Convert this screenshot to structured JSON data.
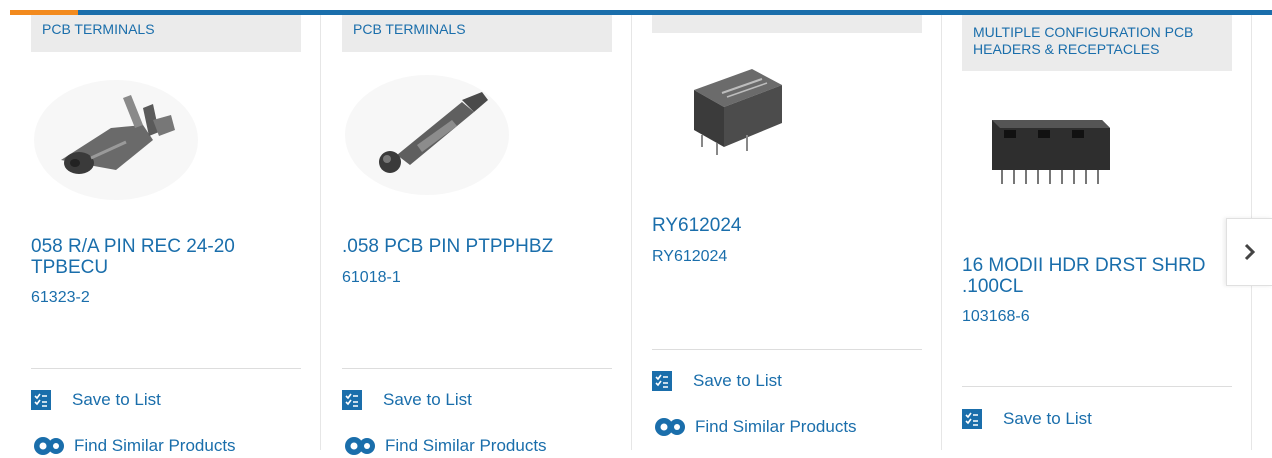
{
  "products": [
    {
      "category": "PCB TERMINALS",
      "title": "058 R/A PIN REC 24-20 TPBECU",
      "part_number": "61323-2",
      "image": "right-angle-pin-receptacle-image",
      "actions": {
        "save": "Save to List",
        "similar": "Find Similar Products"
      }
    },
    {
      "category": "PCB TERMINALS",
      "title": ".058 PCB PIN PTPPHBZ",
      "part_number": "61018-1",
      "image": "pcb-pin-image",
      "actions": {
        "save": "Save to List",
        "similar": "Find Similar Products"
      }
    },
    {
      "category": "",
      "title": "RY612024",
      "part_number": "RY612024",
      "image": "relay-image",
      "actions": {
        "save": "Save to List",
        "similar": "Find Similar Products"
      }
    },
    {
      "category": "MULTIPLE CONFIGURATION PCB HEADERS & RECEPTACLES",
      "title": "16 MODII HDR DRST SHRD .100CL",
      "part_number": "103168-6",
      "image": "header-connector-image",
      "actions": {
        "save": "Save to List"
      }
    }
  ],
  "navigation": {
    "next_icon": "chevron-right-icon"
  },
  "colors": {
    "link": "#1a6eab",
    "top_bar": "#1a6eab",
    "accent": "#f28a1e",
    "category_bg": "#ebebeb"
  }
}
